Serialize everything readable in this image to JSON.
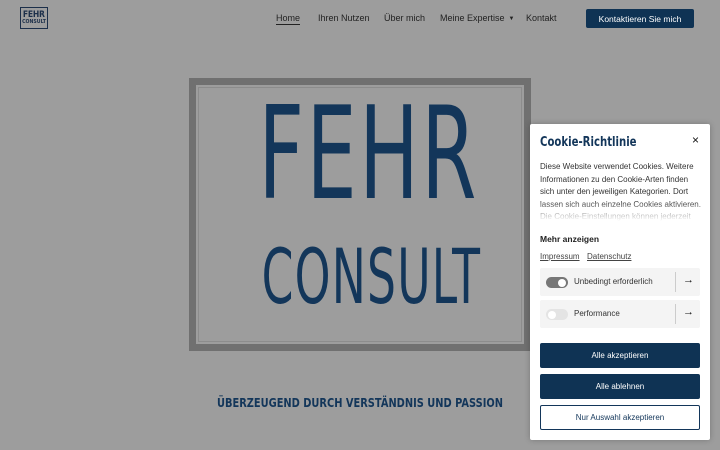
{
  "logo": {
    "line1": "FEHR",
    "line2": "CONSULT"
  },
  "nav": {
    "items": [
      {
        "label": "Home",
        "active": true
      },
      {
        "label": "Ihren Nutzen"
      },
      {
        "label": "Über mich"
      },
      {
        "label": "Meine Expertise",
        "has_dropdown": true
      },
      {
        "label": "Kontakt"
      }
    ],
    "cta_label": "Kontaktieren Sie mich"
  },
  "hero": {
    "line1": "FEHR",
    "line2": "CONSULT"
  },
  "tagline": "ÜBERZEUGEND DURCH VERSTÄNDNIS UND PASSION",
  "cookie": {
    "title": "Cookie-Richtlinie",
    "close_icon": "×",
    "text": "Diese Website verwendet Cookies. Weitere Informationen zu den Cookie-Arten finden sich unter den jeweiligen Kategorien. Dort lassen sich auch einzelne Cookies aktivieren. Die Cookie-Einstellungen können jederzeit",
    "more_label": "Mehr anzeigen",
    "links": {
      "impressum": "Impressum",
      "datenschutz": "Datenschutz"
    },
    "categories": [
      {
        "label": "Unbedingt erforderlich",
        "enabled": true
      },
      {
        "label": "Performance",
        "enabled": false
      }
    ],
    "arrow_icon": "→",
    "accept_all": "Alle akzeptieren",
    "reject_all": "Alle ablehnen",
    "accept_selection": "Nur Auswahl akzeptieren"
  },
  "colors": {
    "brand": "#0f3354",
    "background": "#9d9d9d",
    "frame": "#707070"
  }
}
